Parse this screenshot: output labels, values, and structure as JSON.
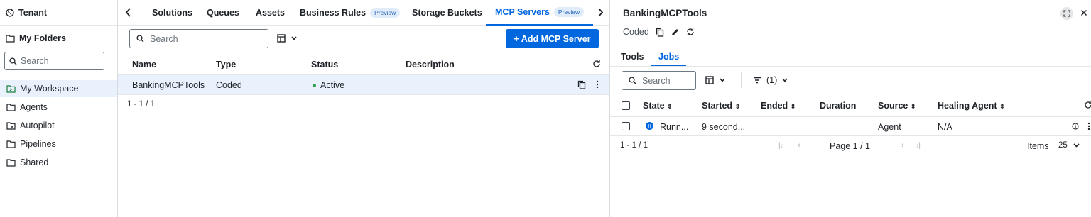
{
  "sidebar": {
    "tenant": "Tenant",
    "my_folders": "My Folders",
    "search_placeholder": "Search",
    "items": [
      {
        "label": "My Workspace",
        "icon": "workspace-folder-icon",
        "selected": true
      },
      {
        "label": "Agents",
        "icon": "folder-icon"
      },
      {
        "label": "Autopilot",
        "icon": "autopilot-folder-icon"
      },
      {
        "label": "Pipelines",
        "icon": "folder-icon"
      },
      {
        "label": "Shared",
        "icon": "folder-icon"
      }
    ]
  },
  "tabs": [
    {
      "label": "Solutions"
    },
    {
      "label": "Queues"
    },
    {
      "label": "Assets"
    },
    {
      "label": "Business Rules",
      "badge": "Preview"
    },
    {
      "label": "Storage Buckets"
    },
    {
      "label": "MCP Servers",
      "badge": "Preview",
      "active": true
    }
  ],
  "list": {
    "search_placeholder": "Search",
    "add_button": "+ Add MCP Server",
    "columns": [
      "Name",
      "Type",
      "Status",
      "Description"
    ],
    "rows": [
      {
        "name": "BankingMCPTools",
        "type": "Coded",
        "status": "Active",
        "description": ""
      }
    ],
    "pagination": "1 - 1 / 1"
  },
  "detail": {
    "title": "BankingMCPTools",
    "subtitle": "Coded",
    "tabs": [
      "Tools",
      "Jobs"
    ],
    "active_tab": "Jobs",
    "search_placeholder": "Search",
    "filter_count": "(1)",
    "columns": [
      "State",
      "Started",
      "Ended",
      "Duration",
      "Source",
      "Healing Agent"
    ],
    "rows": [
      {
        "state": "Runn...",
        "started": "9 second...",
        "ended": "",
        "duration": "",
        "source": "Agent",
        "healing_agent": "N/A"
      }
    ],
    "range": "1 - 1 / 1",
    "page": "Page 1 / 1",
    "items_label": "Items",
    "items_per_page": "25"
  },
  "colors": {
    "accent": "#0067df",
    "active_status": "#2e9e4f",
    "running": "#0067df",
    "selected_row": "#e8f1fc"
  }
}
